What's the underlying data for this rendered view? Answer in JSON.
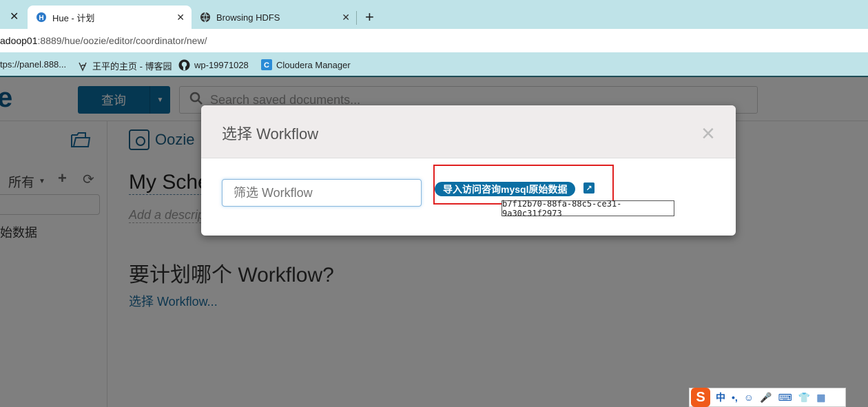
{
  "browser": {
    "tabs": [
      {
        "title": "Hue - 计划",
        "active": true
      },
      {
        "title": "Browsing HDFS",
        "active": false
      }
    ],
    "new_tab": "+",
    "close_glyph": "✕",
    "url": {
      "host": "adoop01",
      "path": ":8889/hue/oozie/editor/coordinator/new/"
    },
    "bookmarks": [
      {
        "label": "tps://panel.888...",
        "icon": "globe-icon"
      },
      {
        "label": "王平的主页 - 博客园",
        "icon": "blog-icon"
      },
      {
        "label": "wp-19971028",
        "icon": "github-icon"
      },
      {
        "label": "Cloudera Manager",
        "icon": "cloudera-icon"
      }
    ]
  },
  "hue": {
    "query_button": "查询",
    "search_placeholder": "Search saved documents...",
    "sidebar": {
      "filter": "所有",
      "item": "始数据"
    },
    "main": {
      "app_title": "Oozie",
      "schedule_name": "My Sche",
      "description_placeholder": "Add a descrip",
      "question": "要计划哪个 Workflow?",
      "choose_link": "选择 Workflow..."
    }
  },
  "modal": {
    "title": "选择 Workflow",
    "close": "×",
    "filter_placeholder": "筛选 Workflow",
    "workflow": {
      "name": "导入访问咨询mysql原始数据",
      "uuid": "b7f12b70-88fa-88c5-ce31-9a30c31f2973"
    }
  },
  "ime": {
    "logo": "S",
    "items": [
      "中",
      "•,",
      "☺",
      "🎤",
      "⌨",
      "👕",
      "▦"
    ]
  },
  "colors": {
    "accent": "#0b6ea3",
    "highlight": "#e02020",
    "browser_chrome": "#bfe3e8"
  }
}
